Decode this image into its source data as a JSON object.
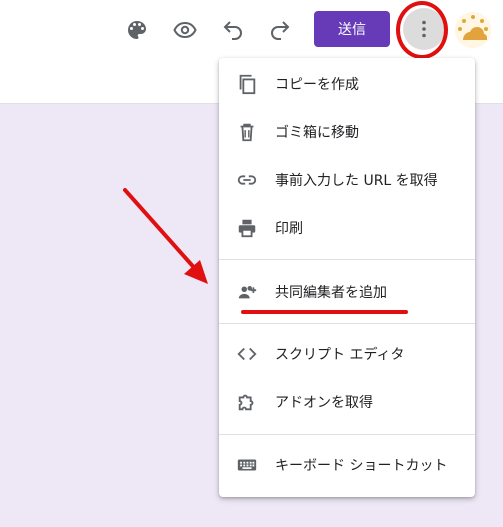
{
  "toolbar": {
    "icons": [
      "palette-icon",
      "preview-eye-icon",
      "undo-icon",
      "redo-icon"
    ],
    "send_label": "送信",
    "more_icon": "more-vert-icon"
  },
  "menu": {
    "items": [
      {
        "label": "コピーを作成",
        "icon": "copy-icon"
      },
      {
        "label": "ゴミ箱に移動",
        "icon": "trash-icon"
      },
      {
        "label": "事前入力した URL を取得",
        "icon": "link-icon"
      },
      {
        "label": "印刷",
        "icon": "print-icon"
      },
      {
        "label": "共同編集者を追加",
        "icon": "add-people-icon"
      },
      {
        "label": "スクリプト エディタ",
        "icon": "code-icon"
      },
      {
        "label": "アドオンを取得",
        "icon": "puzzle-icon"
      },
      {
        "label": "キーボード ショートカット",
        "icon": "keyboard-icon"
      }
    ]
  },
  "annotations_color": "#e01010",
  "accent_color": "#673ab7",
  "background_color": "#ede7f6"
}
